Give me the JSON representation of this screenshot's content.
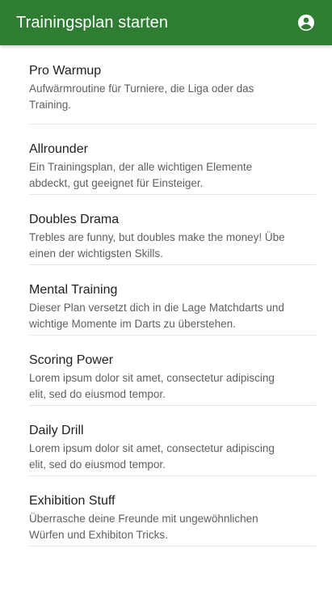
{
  "appbar": {
    "title": "Trainingsplan starten",
    "background": "#2e7d32",
    "account_icon": "account-circle-icon"
  },
  "plans": [
    {
      "title": "Pro Warmup",
      "description": "Aufwärmroutine für Turniere, die Liga oder das Training."
    },
    {
      "title": "Allrounder",
      "description": "Ein Trainingsplan, der alle wichtigen Elemente abdeckt, gut geeignet für Einsteiger."
    },
    {
      "title": "Doubles Drama",
      "description": "Trebles are funny, but doubles make the money! Übe einen der wichtigsten Skills."
    },
    {
      "title": "Mental Training",
      "description": "Dieser Plan versetzt dich in die Lage Matchdarts und wichtige Momente im Darts zu überstehen."
    },
    {
      "title": "Scoring Power",
      "description": "Lorem ipsum dolor sit amet, consectetur adipiscing elit, sed do eiusmod tempor."
    },
    {
      "title": "Daily Drill",
      "description": "Lorem ipsum dolor sit amet, consectetur adipiscing elit, sed do eiusmod tempor."
    },
    {
      "title": "Exhibition Stuff",
      "description": "Überrasche deine Freunde mit ungewöhnlichen Würfen und Exhibiton Tricks."
    }
  ]
}
